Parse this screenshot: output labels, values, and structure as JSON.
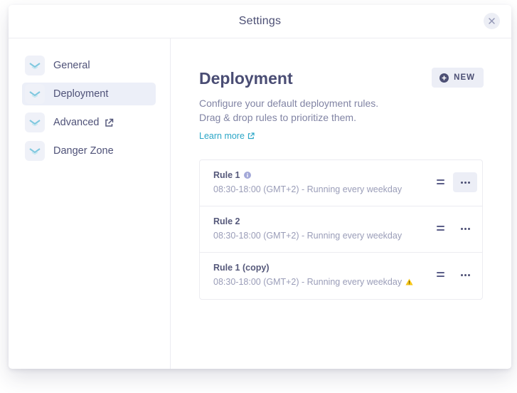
{
  "dialog": {
    "title": "Settings"
  },
  "sidebar": {
    "items": [
      {
        "label": "General",
        "icon": "mail-tray-icon",
        "active": false
      },
      {
        "label": "Deployment",
        "icon": "mail-tray-icon",
        "active": true
      },
      {
        "label": "Advanced",
        "icon": "mail-tray-icon",
        "active": false,
        "external": true
      },
      {
        "label": "Danger Zone",
        "icon": "mail-tray-icon",
        "active": false
      }
    ]
  },
  "main": {
    "title": "Deployment",
    "new_button": "NEW",
    "description_line1": "Configure your default deployment rules.",
    "description_line2": "Drag & drop rules to prioritize them.",
    "learn_more": "Learn more",
    "rules": [
      {
        "name": "Rule 1",
        "schedule": "08:30-18:00 (GMT+2) - Running every weekday",
        "badge": "info-icon",
        "menu_active": true
      },
      {
        "name": "Rule 2",
        "schedule": "08:30-18:00 (GMT+2) - Running every weekday",
        "badge": null,
        "menu_active": false
      },
      {
        "name": "Rule 1 (copy)",
        "schedule": "08:30-18:00 (GMT+2) - Running every weekday",
        "badge": "warning-icon",
        "menu_active": false
      }
    ]
  },
  "colors": {
    "accent": "#2ba6c7",
    "active_bg": "#eceff8",
    "warning": "#f5c518",
    "info": "#a3a8d8"
  }
}
